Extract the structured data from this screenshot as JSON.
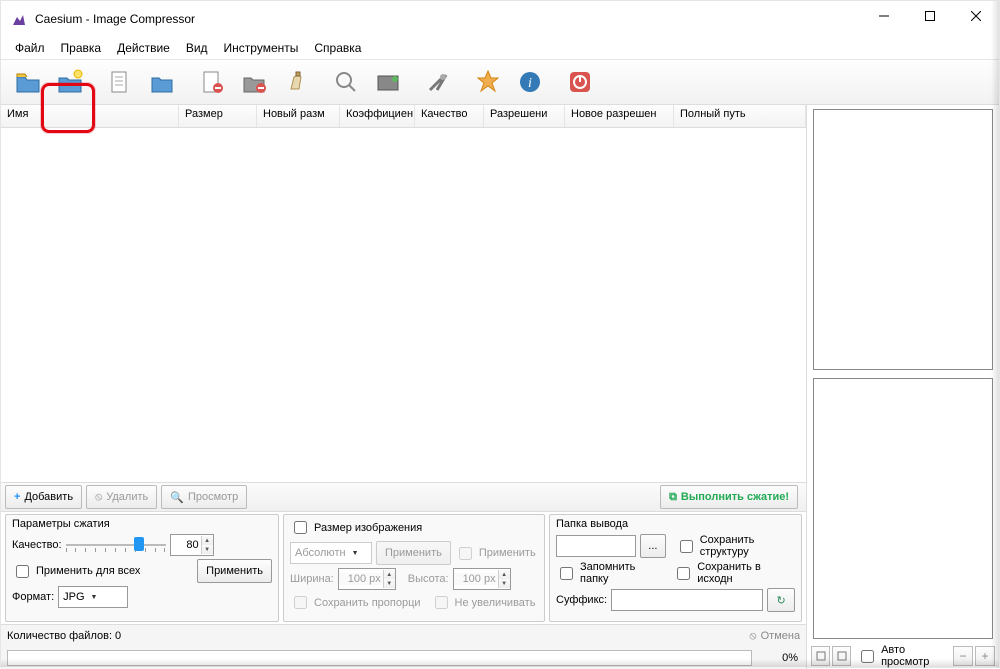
{
  "window": {
    "title": "Caesium - Image Compressor"
  },
  "menu": {
    "file": "Файл",
    "edit": "Правка",
    "action": "Действие",
    "view": "Вид",
    "tools": "Инструменты",
    "help": "Справка"
  },
  "columns": {
    "name": "Имя",
    "size": "Размер",
    "new_size": "Новый разм",
    "ratio": "Коэффициен",
    "quality": "Качество",
    "resolution": "Разрешени",
    "new_resolution": "Новое разрешен",
    "full_path": "Полный путь"
  },
  "list_actions": {
    "add": "Добавить",
    "remove": "Удалить",
    "preview": "Просмотр",
    "compress": "Выполнить сжатие!"
  },
  "group_compress": {
    "title": "Параметры сжатия",
    "quality": "Качество:",
    "quality_value": "80",
    "apply_all": "Применить для всех",
    "apply": "Применить",
    "format": "Формат:",
    "format_value": "JPG"
  },
  "group_size": {
    "title": "Размер изображения",
    "mode": "Абсолютн",
    "apply": "Применить",
    "apply_check": "Применить",
    "width": "Ширина:",
    "width_value": "100 px",
    "height": "Высота:",
    "height_value": "100 px",
    "keep_ratio": "Сохранить пропорци",
    "no_enlarge": "Не увеличивать"
  },
  "group_output": {
    "title": "Папка вывода",
    "browse": "...",
    "keep_structure": "Сохранить структуру",
    "remember": "Запомнить папку",
    "save_in_source": "Сохранить в исходн",
    "suffix": "Суффикс:"
  },
  "status": {
    "file_count": "Количество файлов: 0",
    "cancel": "Отмена",
    "percent": "0%"
  },
  "preview": {
    "auto_label": "Авто просмотр"
  }
}
